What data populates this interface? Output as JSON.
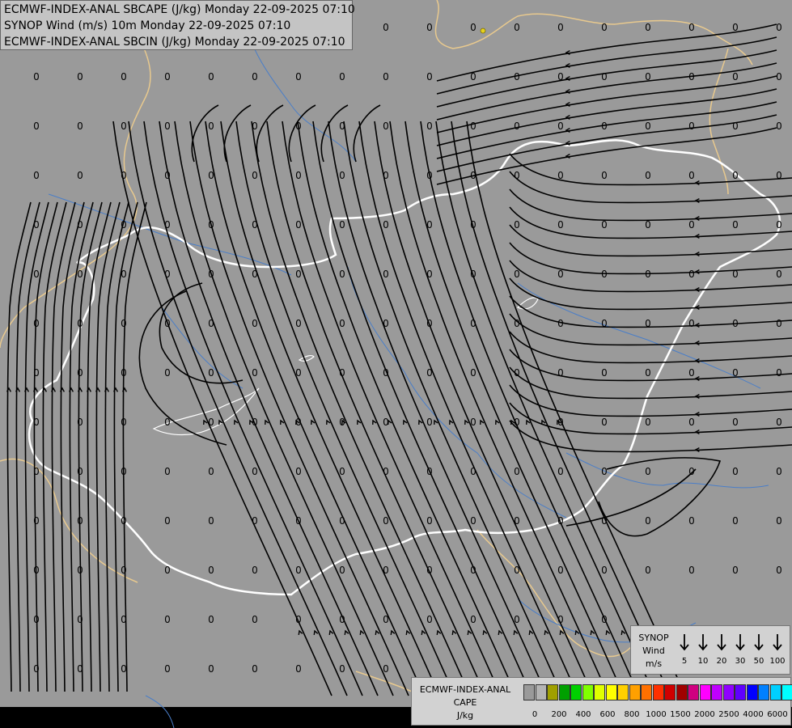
{
  "titles": [
    "ECMWF-INDEX-ANAL SBCAPE (J/kg) Monday 22-09-2025 07:10",
    "SYNOP Wind (m/s) 10m Monday 22-09-2025 07:10",
    "ECMWF-INDEX-ANAL SBCIN (J/kg) Monday 22-09-2025 07:10"
  ],
  "colors": {
    "background": "#9a9a9a",
    "streamline": "#000000",
    "country_border": "#ffffff",
    "region_border": "#e8c98e",
    "river": "#4a7ec8"
  },
  "cape_value_label": "0",
  "wind_legend": {
    "title_lines": [
      "SYNOP",
      "Wind",
      "m/s"
    ],
    "speeds": [
      "5",
      "10",
      "20",
      "30",
      "50",
      "100"
    ],
    "icon": "arrow-down-icon"
  },
  "cape_legend": {
    "title_lines": [
      "ECMWF-INDEX-ANAL",
      "CAPE",
      "J/kg"
    ],
    "colors": [
      "#9a9a9a",
      "#b4b4b4",
      "#a0a000",
      "#00a000",
      "#00d000",
      "#80ff00",
      "#e0ff00",
      "#ffff00",
      "#ffd000",
      "#ffa000",
      "#ff7000",
      "#ff3000",
      "#d00000",
      "#a00000",
      "#d00080",
      "#ff00ff",
      "#c000ff",
      "#9000ff",
      "#6000ff",
      "#0000ff",
      "#0080ff",
      "#00d0ff",
      "#00ffff",
      "#ffffff"
    ],
    "ticks": [
      "0",
      "200",
      "400",
      "600",
      "800",
      "1000",
      "1500",
      "2000",
      "2500",
      "4000",
      "6000"
    ]
  }
}
